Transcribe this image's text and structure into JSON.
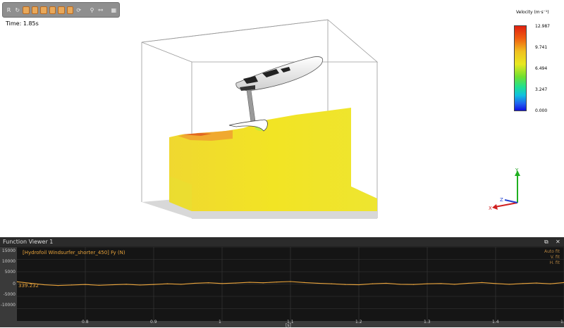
{
  "toolbar": {
    "reset_label": "R",
    "grid_label": "▦"
  },
  "scene": {
    "time_label": "Time: 1.85s"
  },
  "legend": {
    "title": "Velocity (m·s⁻¹)",
    "ticks": [
      "12.987",
      "9.741",
      "6.494",
      "3.247",
      "0.000"
    ]
  },
  "axes": {
    "x": "X",
    "y": "Y",
    "z": "Z"
  },
  "function_viewer": {
    "title": "Function Viewer 1",
    "series_title": "[Hydrofoil Windsurfer_shorter_450] Fy (N)",
    "options": [
      "Auto fit",
      "V. fit",
      "H. fit"
    ],
    "readout": "339.232",
    "y_ticks": [
      "15000",
      "10000",
      "5000",
      "0",
      "-5000",
      "-10000"
    ],
    "x_ticks": [
      "0.8",
      "0.9",
      "1",
      "1.1",
      "1.2",
      "1.3",
      "1.4",
      "1.5"
    ],
    "x_label": "[s]",
    "colors": {
      "series": "#e8a23a",
      "background": "#151515"
    }
  },
  "chart_data": {
    "type": "line",
    "title": "[Hydrofoil Windsurfer_shorter_450] Fy (N)",
    "xlabel": "[s]",
    "ylabel": "",
    "xlim": [
      0.7,
      1.5
    ],
    "ylim": [
      -15000,
      15000
    ],
    "grid": true,
    "series": [
      {
        "name": "[Hydrofoil Windsurfer_shorter_450] Fy (N)",
        "x": [
          0.7,
          0.72,
          0.74,
          0.76,
          0.78,
          0.8,
          0.82,
          0.84,
          0.86,
          0.88,
          0.9,
          0.92,
          0.94,
          0.96,
          0.98,
          1.0,
          1.02,
          1.04,
          1.06,
          1.08,
          1.1,
          1.12,
          1.14,
          1.16,
          1.18,
          1.2,
          1.22,
          1.24,
          1.26,
          1.28,
          1.3,
          1.32,
          1.34,
          1.36,
          1.38,
          1.4,
          1.42,
          1.44,
          1.46,
          1.48,
          1.5
        ],
        "y": [
          900,
          300,
          -300,
          -600,
          -400,
          -200,
          -500,
          -300,
          -100,
          -400,
          -200,
          100,
          -100,
          300,
          500,
          200,
          400,
          700,
          500,
          800,
          1000,
          600,
          300,
          100,
          -200,
          -300,
          100,
          300,
          -100,
          -200,
          100,
          200,
          -100,
          300,
          600,
          200,
          -100,
          200,
          400,
          100,
          600
        ]
      }
    ]
  }
}
